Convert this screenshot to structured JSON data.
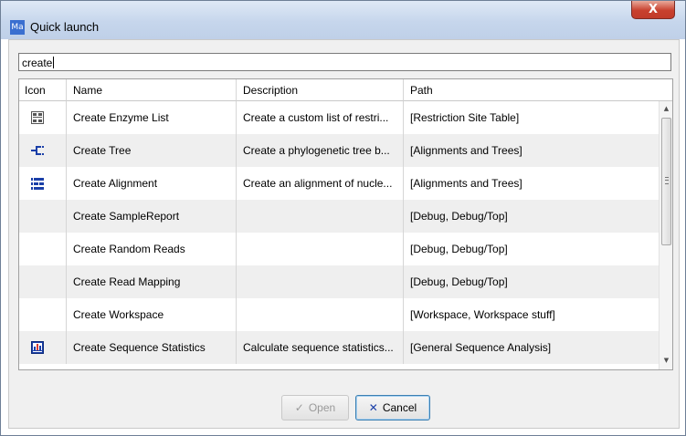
{
  "window": {
    "icon_text": "Ma",
    "title": "Quick launch",
    "close_glyph": "X"
  },
  "search": {
    "value": "create"
  },
  "table": {
    "columns": [
      "Icon",
      "Name",
      "Description",
      "Path"
    ],
    "rows": [
      {
        "icon": "enzyme-list-icon",
        "name": "Create Enzyme List",
        "description": "Create a custom list of restri...",
        "path": "[Restriction Site Table]"
      },
      {
        "icon": "tree-icon",
        "name": "Create Tree",
        "description": "Create a phylogenetic tree b...",
        "path": "[Alignments and Trees]"
      },
      {
        "icon": "alignment-icon",
        "name": "Create Alignment",
        "description": "Create an alignment of nucle...",
        "path": "[Alignments and Trees]"
      },
      {
        "icon": "",
        "name": "Create SampleReport",
        "description": "",
        "path": "[Debug, Debug/Top]"
      },
      {
        "icon": "",
        "name": "Create Random Reads",
        "description": "",
        "path": "[Debug, Debug/Top]"
      },
      {
        "icon": "",
        "name": "Create Read Mapping",
        "description": "",
        "path": "[Debug, Debug/Top]"
      },
      {
        "icon": "",
        "name": "Create Workspace",
        "description": "",
        "path": "[Workspace, Workspace stuff]"
      },
      {
        "icon": "sequence-statistics-icon",
        "name": "Create Sequence Statistics",
        "description": "Calculate sequence statistics...",
        "path": "[General Sequence Analysis]"
      }
    ]
  },
  "buttons": {
    "open_label": "Open",
    "open_icon": "checkmark-icon",
    "open_enabled": false,
    "cancel_label": "Cancel",
    "cancel_icon": "x-icon"
  },
  "colors": {
    "title_gradient_top": "#dfe9f6",
    "close_button": "#c8402e",
    "row_alt": "#efefef",
    "icon_blue": "#1a3fa8"
  }
}
